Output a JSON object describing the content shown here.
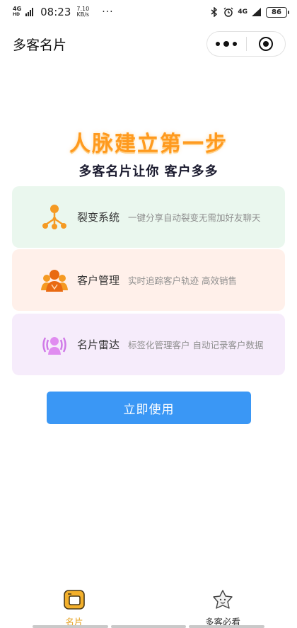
{
  "status_bar": {
    "network": "4G",
    "network_sub": "HD",
    "time": "08:23",
    "speed_value": "7.10",
    "speed_unit": "KB/s",
    "more": "···",
    "right_network": "4G",
    "battery": "86"
  },
  "nav": {
    "title": "多客名片"
  },
  "hero": {
    "title": "人脉建立第一步",
    "subtitle": "多客名片让你 客户多多"
  },
  "features": [
    {
      "name": "裂变系统",
      "desc": "一键分享自动裂变无需加好友聊天",
      "icon": "fission-network-icon",
      "color": "#f59a23"
    },
    {
      "name": "客户管理",
      "desc": "实时追踪客户轨迹 高效销售",
      "icon": "customer-group-icon",
      "color": "#f07c1e"
    },
    {
      "name": "名片雷达",
      "desc": "标签化管理客户 自动记录客户数据",
      "icon": "radar-person-icon",
      "color": "#d07ae8"
    }
  ],
  "cta": {
    "label": "立即使用"
  },
  "tabs": [
    {
      "label": "名片",
      "icon": "card-tab-icon",
      "active": true
    },
    {
      "label": "多客必看",
      "icon": "star-face-icon",
      "active": false
    }
  ],
  "colors": {
    "accent": "#3a97f5",
    "hero": "#ff9a1e",
    "tab_active": "#e6a01e"
  }
}
